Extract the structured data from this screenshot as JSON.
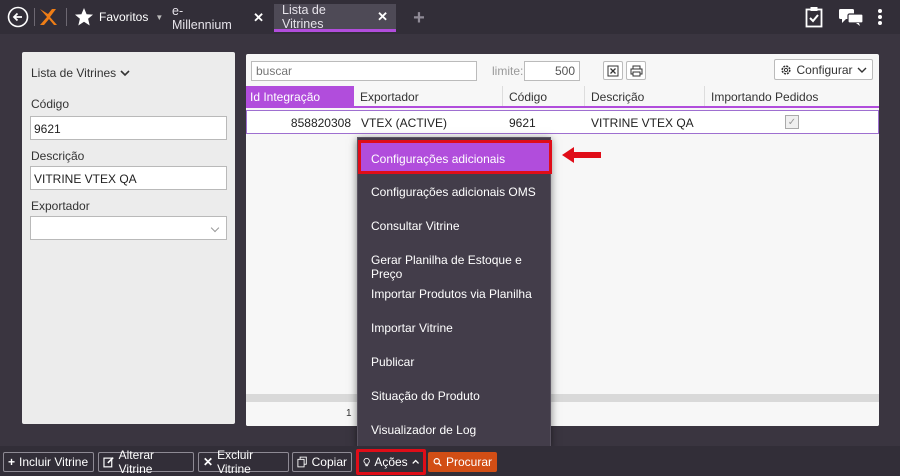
{
  "topbar": {
    "favorites_label": "Favoritos",
    "tabs": [
      {
        "label": "e-Millennium",
        "close": "✕"
      },
      {
        "label": "Lista de Vitrines",
        "close": "✕"
      }
    ],
    "new_tab": "+"
  },
  "left_panel": {
    "title": "Lista de Vitrines",
    "codigo_label": "Código",
    "codigo_value": "9621",
    "descricao_label": "Descrição",
    "descricao_value": "VITRINE VTEX QA",
    "exportador_label": "Exportador",
    "exportador_value": ""
  },
  "toolbar": {
    "search_placeholder": "buscar",
    "limite_label": "limite:",
    "limite_value": "500",
    "configurar_label": "Configurar"
  },
  "grid": {
    "columns": [
      "Id Integração",
      "Exportador",
      "Código",
      "Descrição",
      "Importando Pedidos"
    ],
    "rows": [
      {
        "id": "858820308",
        "exportador": "VTEX (ACTIVE)",
        "codigo": "9621",
        "descricao": "VITRINE VTEX QA",
        "importando": true
      }
    ],
    "page": "1"
  },
  "menu": {
    "items": [
      "Configurações adicionais",
      "Configurações adicionais OMS",
      "Consultar Vitrine",
      "Gerar Planilha de Estoque e Preço",
      "Importar Produtos via Planilha",
      "Importar Vitrine",
      "Publicar",
      "Situação do Produto",
      "Visualizador de Log"
    ]
  },
  "bottombar": {
    "incluir": "Incluir Vitrine",
    "alterar": "Alterar Vitrine",
    "excluir": "Excluir Vitrine",
    "copiar": "Copiar",
    "acoes": "Ações",
    "procurar": "Procurar"
  },
  "colors": {
    "accent": "#b14ddc",
    "highlight": "#e00d18",
    "procurar": "#d24e15",
    "bar": "#322e38"
  }
}
